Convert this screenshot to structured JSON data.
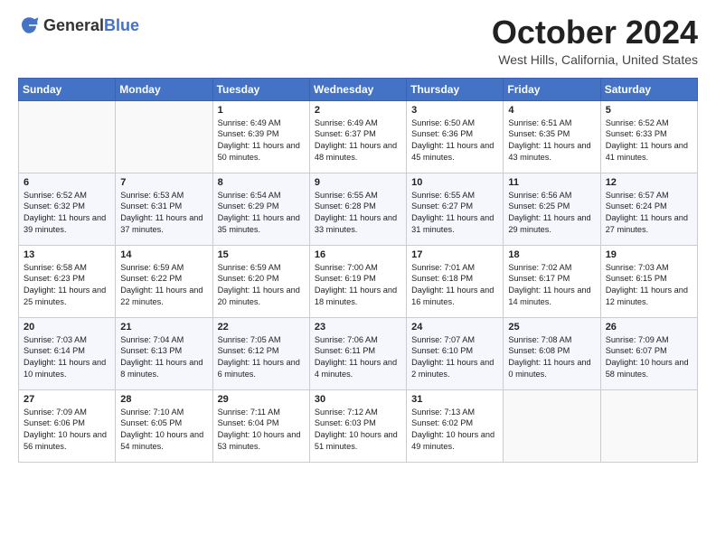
{
  "header": {
    "logo_general": "General",
    "logo_blue": "Blue",
    "month_title": "October 2024",
    "location": "West Hills, California, United States"
  },
  "days_of_week": [
    "Sunday",
    "Monday",
    "Tuesday",
    "Wednesday",
    "Thursday",
    "Friday",
    "Saturday"
  ],
  "weeks": [
    [
      {
        "day": "",
        "info": ""
      },
      {
        "day": "",
        "info": ""
      },
      {
        "day": "1",
        "info": "Sunrise: 6:49 AM\nSunset: 6:39 PM\nDaylight: 11 hours and 50 minutes."
      },
      {
        "day": "2",
        "info": "Sunrise: 6:49 AM\nSunset: 6:37 PM\nDaylight: 11 hours and 48 minutes."
      },
      {
        "day": "3",
        "info": "Sunrise: 6:50 AM\nSunset: 6:36 PM\nDaylight: 11 hours and 45 minutes."
      },
      {
        "day": "4",
        "info": "Sunrise: 6:51 AM\nSunset: 6:35 PM\nDaylight: 11 hours and 43 minutes."
      },
      {
        "day": "5",
        "info": "Sunrise: 6:52 AM\nSunset: 6:33 PM\nDaylight: 11 hours and 41 minutes."
      }
    ],
    [
      {
        "day": "6",
        "info": "Sunrise: 6:52 AM\nSunset: 6:32 PM\nDaylight: 11 hours and 39 minutes."
      },
      {
        "day": "7",
        "info": "Sunrise: 6:53 AM\nSunset: 6:31 PM\nDaylight: 11 hours and 37 minutes."
      },
      {
        "day": "8",
        "info": "Sunrise: 6:54 AM\nSunset: 6:29 PM\nDaylight: 11 hours and 35 minutes."
      },
      {
        "day": "9",
        "info": "Sunrise: 6:55 AM\nSunset: 6:28 PM\nDaylight: 11 hours and 33 minutes."
      },
      {
        "day": "10",
        "info": "Sunrise: 6:55 AM\nSunset: 6:27 PM\nDaylight: 11 hours and 31 minutes."
      },
      {
        "day": "11",
        "info": "Sunrise: 6:56 AM\nSunset: 6:25 PM\nDaylight: 11 hours and 29 minutes."
      },
      {
        "day": "12",
        "info": "Sunrise: 6:57 AM\nSunset: 6:24 PM\nDaylight: 11 hours and 27 minutes."
      }
    ],
    [
      {
        "day": "13",
        "info": "Sunrise: 6:58 AM\nSunset: 6:23 PM\nDaylight: 11 hours and 25 minutes."
      },
      {
        "day": "14",
        "info": "Sunrise: 6:59 AM\nSunset: 6:22 PM\nDaylight: 11 hours and 22 minutes."
      },
      {
        "day": "15",
        "info": "Sunrise: 6:59 AM\nSunset: 6:20 PM\nDaylight: 11 hours and 20 minutes."
      },
      {
        "day": "16",
        "info": "Sunrise: 7:00 AM\nSunset: 6:19 PM\nDaylight: 11 hours and 18 minutes."
      },
      {
        "day": "17",
        "info": "Sunrise: 7:01 AM\nSunset: 6:18 PM\nDaylight: 11 hours and 16 minutes."
      },
      {
        "day": "18",
        "info": "Sunrise: 7:02 AM\nSunset: 6:17 PM\nDaylight: 11 hours and 14 minutes."
      },
      {
        "day": "19",
        "info": "Sunrise: 7:03 AM\nSunset: 6:15 PM\nDaylight: 11 hours and 12 minutes."
      }
    ],
    [
      {
        "day": "20",
        "info": "Sunrise: 7:03 AM\nSunset: 6:14 PM\nDaylight: 11 hours and 10 minutes."
      },
      {
        "day": "21",
        "info": "Sunrise: 7:04 AM\nSunset: 6:13 PM\nDaylight: 11 hours and 8 minutes."
      },
      {
        "day": "22",
        "info": "Sunrise: 7:05 AM\nSunset: 6:12 PM\nDaylight: 11 hours and 6 minutes."
      },
      {
        "day": "23",
        "info": "Sunrise: 7:06 AM\nSunset: 6:11 PM\nDaylight: 11 hours and 4 minutes."
      },
      {
        "day": "24",
        "info": "Sunrise: 7:07 AM\nSunset: 6:10 PM\nDaylight: 11 hours and 2 minutes."
      },
      {
        "day": "25",
        "info": "Sunrise: 7:08 AM\nSunset: 6:08 PM\nDaylight: 11 hours and 0 minutes."
      },
      {
        "day": "26",
        "info": "Sunrise: 7:09 AM\nSunset: 6:07 PM\nDaylight: 10 hours and 58 minutes."
      }
    ],
    [
      {
        "day": "27",
        "info": "Sunrise: 7:09 AM\nSunset: 6:06 PM\nDaylight: 10 hours and 56 minutes."
      },
      {
        "day": "28",
        "info": "Sunrise: 7:10 AM\nSunset: 6:05 PM\nDaylight: 10 hours and 54 minutes."
      },
      {
        "day": "29",
        "info": "Sunrise: 7:11 AM\nSunset: 6:04 PM\nDaylight: 10 hours and 53 minutes."
      },
      {
        "day": "30",
        "info": "Sunrise: 7:12 AM\nSunset: 6:03 PM\nDaylight: 10 hours and 51 minutes."
      },
      {
        "day": "31",
        "info": "Sunrise: 7:13 AM\nSunset: 6:02 PM\nDaylight: 10 hours and 49 minutes."
      },
      {
        "day": "",
        "info": ""
      },
      {
        "day": "",
        "info": ""
      }
    ]
  ]
}
